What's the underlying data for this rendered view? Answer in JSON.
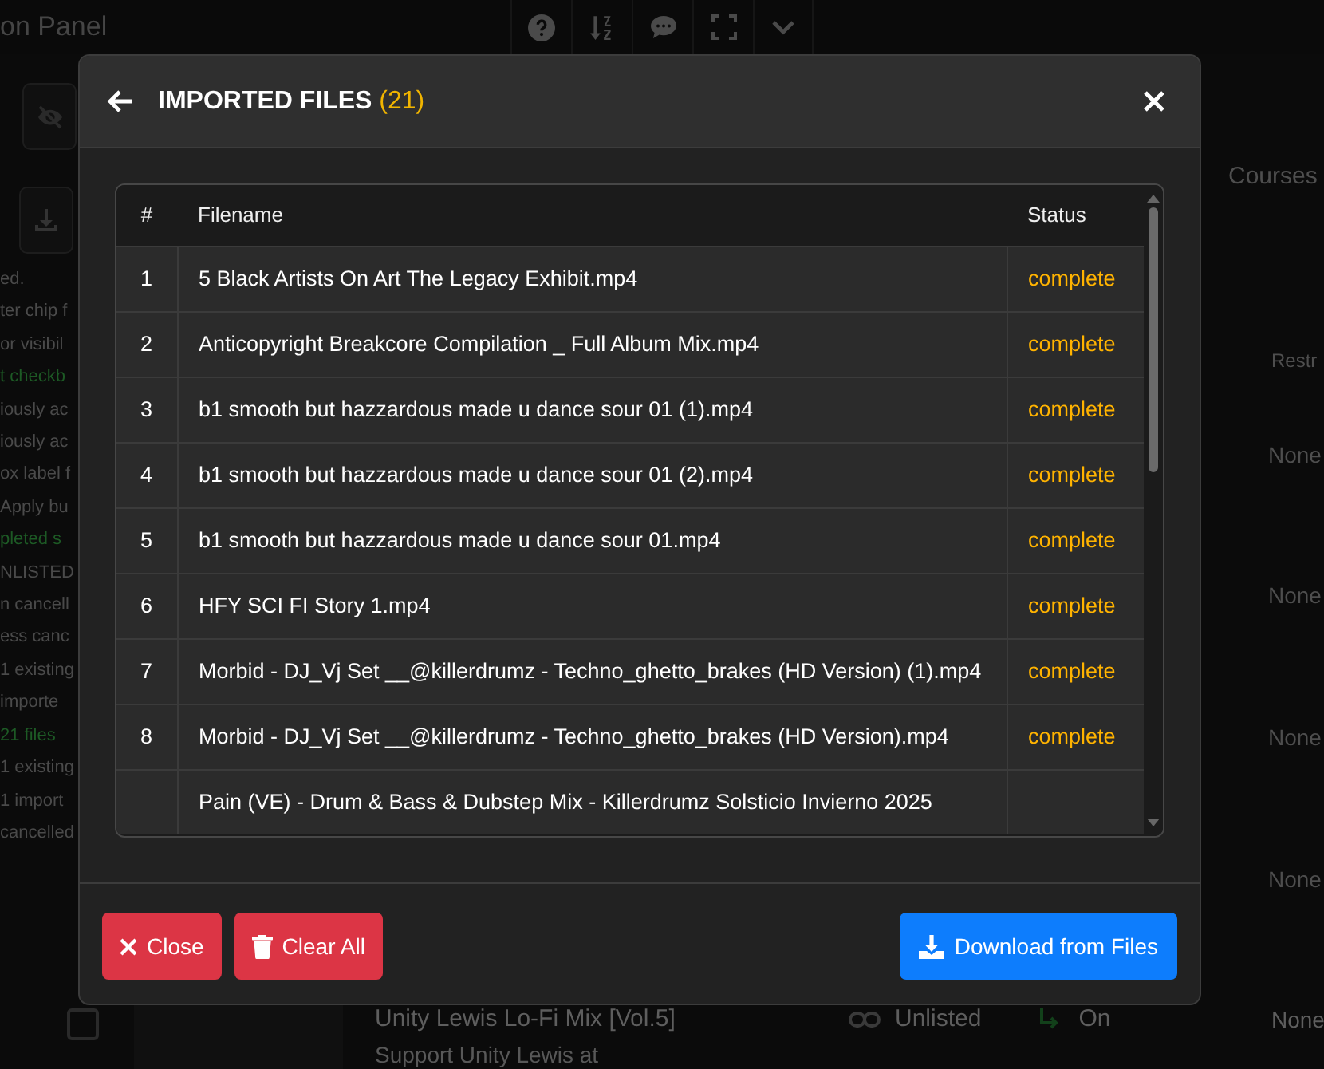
{
  "page_header": {
    "title": "on Panel"
  },
  "log_lines": [
    {
      "text": "ed.",
      "kind": "info"
    },
    {
      "text": "ter chip f",
      "kind": "info"
    },
    {
      "text": "or visibil",
      "kind": "info"
    },
    {
      "text": "t checkb",
      "kind": "success"
    },
    {
      "text": "iously ac",
      "kind": "info"
    },
    {
      "text": "iously ac",
      "kind": "info"
    },
    {
      "text": "ox label f",
      "kind": "info"
    },
    {
      "text": "Apply bu",
      "kind": "info"
    },
    {
      "text": "pleted s",
      "kind": "success"
    },
    {
      "text": "NLISTED",
      "kind": "info"
    },
    {
      "text": "n cancell",
      "kind": "info"
    },
    {
      "text": "ess canc",
      "kind": "info"
    },
    {
      "text": "1 existing",
      "kind": "info"
    },
    {
      "text": "importe",
      "kind": "info"
    },
    {
      "text": "21 files",
      "kind": "success"
    },
    {
      "text": "1 existing",
      "kind": "info"
    },
    {
      "text": "1 import",
      "kind": "info"
    },
    {
      "text": "cancelled",
      "kind": "info"
    }
  ],
  "right_panel": {
    "heading": "Courses",
    "column_header": "Restr",
    "cells": [
      "None",
      "None",
      "None",
      "None"
    ]
  },
  "bottom_row": {
    "checked": false,
    "title": "Unity Lewis Lo-Fi Mix [Vol.5]",
    "description": "Support Unity Lewis at",
    "visibility": "Unlisted",
    "toggle": "On",
    "restriction": "None"
  },
  "modal": {
    "title": "IMPORTED FILES",
    "count": "(21)",
    "columns": [
      "#",
      "Filename",
      "Status"
    ],
    "rows": [
      {
        "number": "1",
        "filename": "5 Black Artists On Art The Legacy Exhibit.mp4",
        "status": "complete"
      },
      {
        "number": "2",
        "filename": "Anticopyright Breakcore Compilation _ Full Album Mix.mp4",
        "status": "complete"
      },
      {
        "number": "3",
        "filename": "b1 smooth but hazzardous made u dance sour 01 (1).mp4",
        "status": "complete"
      },
      {
        "number": "4",
        "filename": "b1 smooth but hazzardous made u dance sour 01 (2).mp4",
        "status": "complete"
      },
      {
        "number": "5",
        "filename": "b1 smooth but hazzardous made u dance sour 01.mp4",
        "status": "complete"
      },
      {
        "number": "6",
        "filename": "HFY SCI FI Story 1.mp4",
        "status": "complete"
      },
      {
        "number": "7",
        "filename": "Morbid - DJ_Vj Set __@killerdrumz - Techno_ghetto_brakes (HD Version) (1).mp4",
        "status": "complete"
      },
      {
        "number": "8",
        "filename": "Morbid - DJ_Vj Set __@killerdrumz - Techno_ghetto_brakes (HD Version).mp4",
        "status": "complete"
      },
      {
        "filename": "Pain (VE) - Drum & Bass & Dubstep Mix - Killerdrumz Solsticio Invierno 2025"
      }
    ],
    "buttons": [
      {
        "label": "Close",
        "kind": "close"
      },
      {
        "label": "Clear All",
        "kind": "clear"
      },
      {
        "label": "Download from Files",
        "kind": "download"
      }
    ]
  }
}
